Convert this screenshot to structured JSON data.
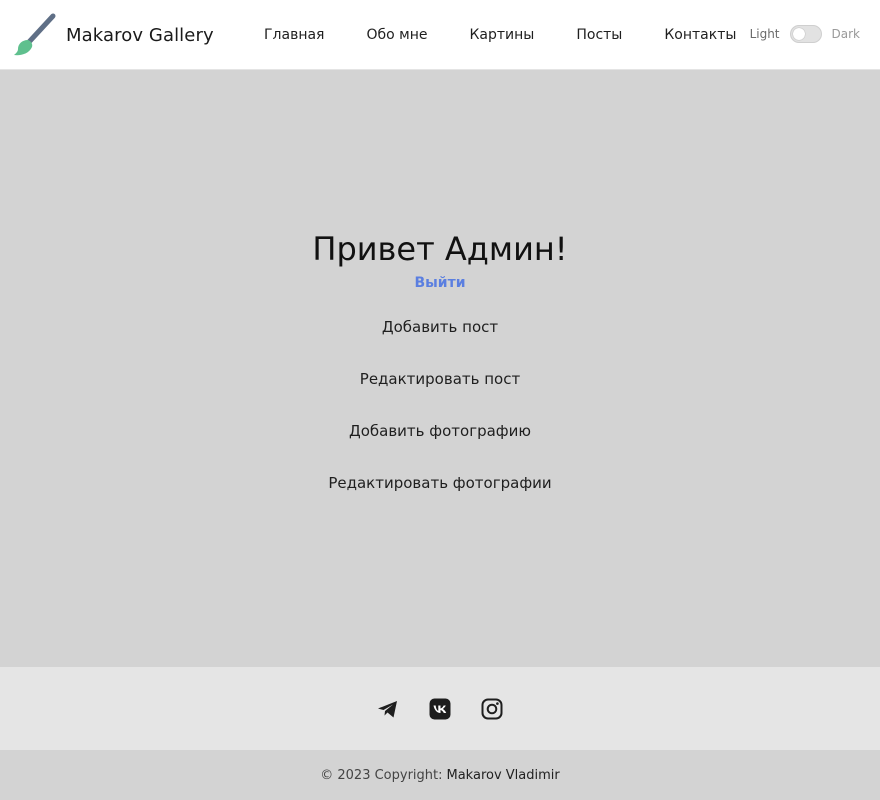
{
  "navbar": {
    "brand": "Makarov Gallery",
    "links": [
      "Главная",
      "Обо мне",
      "Картины",
      "Посты",
      "Контакты"
    ],
    "theme": {
      "light_label": "Light",
      "dark_label": "Dark",
      "mode": "light"
    }
  },
  "main": {
    "greeting": "Привет Админ!",
    "logout": "Выйти",
    "actions": [
      "Добавить пост",
      "Редактировать пост",
      "Добавить фотографию",
      "Редактировать фотографии"
    ]
  },
  "footer": {
    "social_icons": [
      "telegram-icon",
      "vk-icon",
      "instagram-icon"
    ],
    "copyright_prefix": "© 2023 Copyright:",
    "owner": "Makarov Vladimir"
  },
  "colors": {
    "accent": "#5b7fe0",
    "background": "#d3d3d3",
    "footer_bar": "#e5e5e5"
  }
}
